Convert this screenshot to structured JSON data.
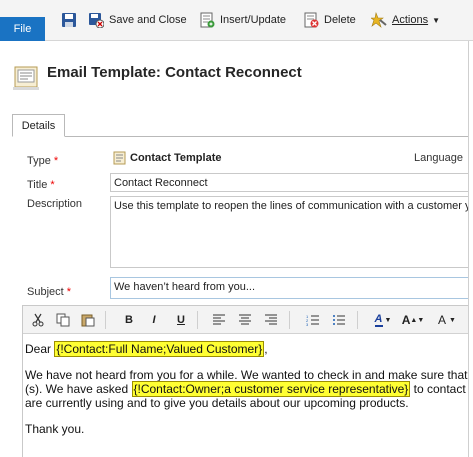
{
  "ribbon": {
    "file_label": "File",
    "save_label": "Save and Close",
    "insert_label": "Insert/Update",
    "delete_label": "Delete",
    "actions_label": "Actions"
  },
  "header": {
    "title": "Email Template: Contact Reconnect"
  },
  "tabs": [
    {
      "label": "Details"
    }
  ],
  "fields": {
    "type_label": "Type",
    "type_value": "Contact Template",
    "language_label": "Language",
    "title_label": "Title",
    "title_value": "Contact Reconnect",
    "description_label": "Description",
    "description_value": "Use this template to reopen the lines of communication with a customer y",
    "subject_label": "Subject",
    "subject_value": "We haven’t heard from you..."
  },
  "editor_toolbar": {
    "bold": "B",
    "italic": "I",
    "underline": "U",
    "font_color": "A",
    "font_size": "A",
    "font_family": "A"
  },
  "body": {
    "dear": "Dear ",
    "slug_name": "{!Contact:Full Name;Valued Customer}",
    "after_name": ",",
    "line2a": "We have not heard from you for a while. We wanted to check in and make sure that",
    "line3a": "(s). We have asked ",
    "slug_owner": "{!Contact:Owner;a customer service representative}",
    "line3b": " to contact",
    "line4": "are currently using and to give you details about our upcoming products.",
    "thanks": "Thank you."
  },
  "colors": {
    "file_tab": "#1a73c3",
    "slug_highlight": "#ffff33",
    "required": "#e00000"
  }
}
